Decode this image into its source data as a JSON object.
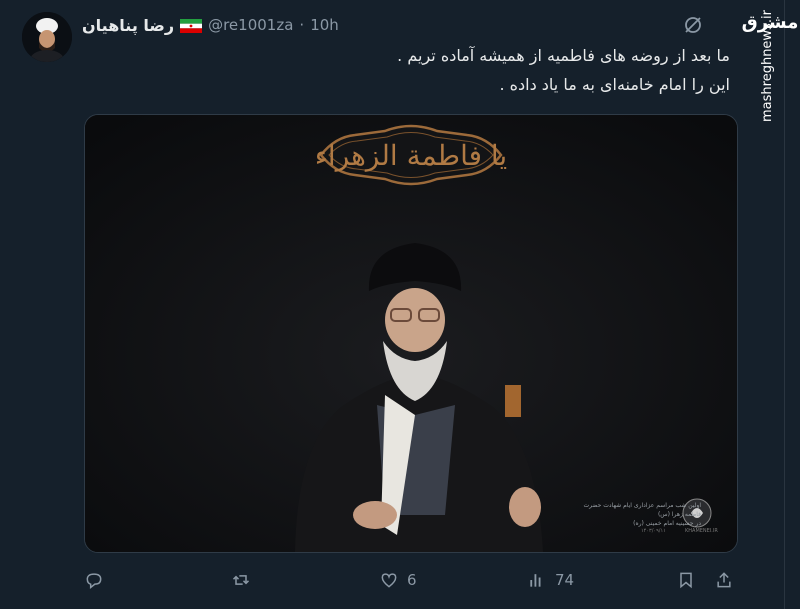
{
  "author": {
    "name": "رضا پناهیان",
    "handle": "@re1001za",
    "separator": "·",
    "time": "10h"
  },
  "tweet": {
    "lines": [
      "ما بعد از روضه های فاطمیه از همیشه آماده تریم .",
      "این را امام خامنه‌ای به ما یاد داده ."
    ]
  },
  "media": {
    "banner": "یا فاطمة الزهراء",
    "caption_lines": [
      "اولین شب مراسم عزاداری ایام شهادت حضرت فاطمه زهرا (س)",
      "در حسینیه امام خمینی (ره)"
    ],
    "caption_date": "۱۴۰۳/۰۹/۱۱",
    "caption_site": "KHAMENEI.IR"
  },
  "actions": {
    "reply_count": "",
    "retweet_count": "",
    "like_count": "6",
    "views_count": "74"
  },
  "watermark": {
    "logo": "مشرق",
    "site": "mashreghnews.ir"
  },
  "icons": {
    "reply": "reply-icon",
    "retweet": "retweet-icon",
    "like": "heart-icon",
    "views": "views-icon",
    "bookmark": "bookmark-icon",
    "share": "share-icon",
    "grok": "grok-icon"
  },
  "colors": {
    "background": "#15202b",
    "text": "#e7e9ea",
    "muted": "#8b98a5",
    "banner_gold": "#b07a44"
  }
}
